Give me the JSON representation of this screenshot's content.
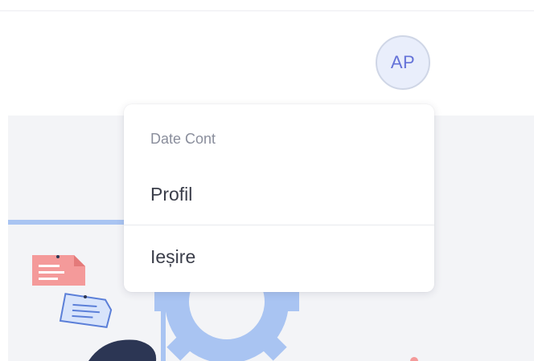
{
  "user": {
    "initials": "AP"
  },
  "menu": {
    "header": "Date Cont",
    "items": [
      {
        "label": "Profil"
      },
      {
        "label": "Ieșire"
      }
    ]
  },
  "colors": {
    "accent": "#6472d8",
    "avatar_bg": "#e9eefb",
    "illustration_blue": "#a9c4f2",
    "illustration_red": "#f49a9a",
    "illustration_dark": "#2c3654"
  },
  "icons": [
    "document-icon",
    "gear-icon"
  ]
}
